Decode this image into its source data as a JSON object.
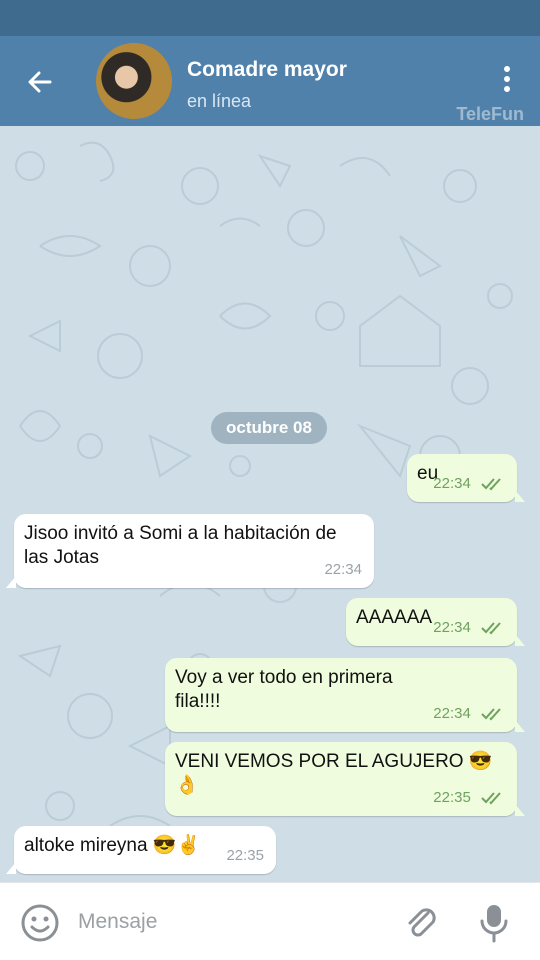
{
  "header": {
    "title": "Comadre mayor",
    "status": "en línea",
    "watermark": "TeleFun",
    "back_icon": "arrow-left-icon",
    "menu_icon": "more-vertical-icon"
  },
  "chat": {
    "date": "octubre 08",
    "messages": [
      {
        "dir": "out",
        "text": "eu",
        "time": "22:34",
        "read": true
      },
      {
        "dir": "in",
        "text": "Jisoo invitó a Somi a la habitación de las Jotas",
        "time": "22:34"
      },
      {
        "dir": "out",
        "text": "AAAAAA",
        "time": "22:34",
        "read": true
      },
      {
        "dir": "out",
        "text": "Voy a ver todo en primera fila!!!!",
        "time": "22:34",
        "read": true
      },
      {
        "dir": "out",
        "text": "VENI VEMOS POR EL AGUJERO 😎 👌",
        "time": "22:35",
        "read": true
      },
      {
        "dir": "in",
        "text": "altoke mireyna 😎✌️",
        "time": "22:35"
      }
    ]
  },
  "input": {
    "placeholder": "Mensaje",
    "emoji_icon": "smile-icon",
    "attach_icon": "paperclip-icon",
    "mic_icon": "microphone-icon"
  },
  "colors": {
    "header": "#5081aa",
    "statusbar": "#3f6b8f",
    "outgoing_bubble": "#effdde",
    "incoming_bubble": "#ffffff",
    "check_color": "#6fa15f"
  }
}
